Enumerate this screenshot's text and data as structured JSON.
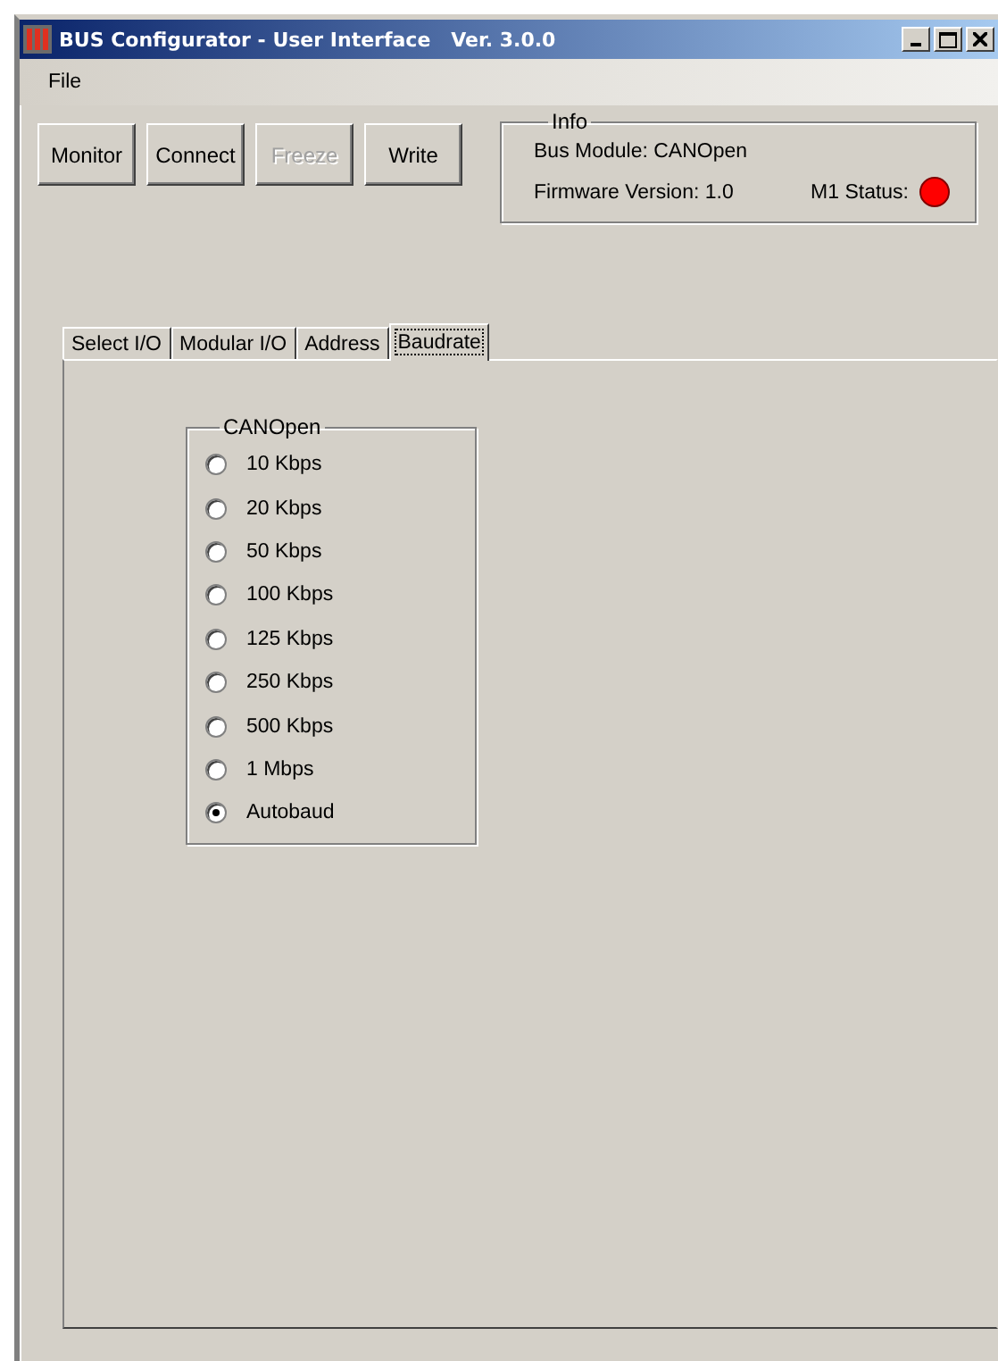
{
  "window": {
    "title": "BUS Configurator - User Interface   Ver. 3.0.0"
  },
  "menu": [
    "File"
  ],
  "buttons": [
    {
      "label": "Monitor",
      "disabled": false
    },
    {
      "label": "Connect",
      "disabled": false
    },
    {
      "label": "Freeze",
      "disabled": true
    },
    {
      "label": "Write",
      "disabled": false
    }
  ],
  "info": {
    "title": "Info",
    "bus_module": "Bus Module: CANOpen",
    "firmware": "Firmware Version: 1.0",
    "status_label": "M1 Status:"
  },
  "tabs": [
    {
      "label": "Select I/O",
      "selected": false
    },
    {
      "label": "Modular I/O",
      "selected": false
    },
    {
      "label": "Address",
      "selected": false
    },
    {
      "label": "Baudrate",
      "selected": true
    }
  ],
  "baudrate_group": {
    "title": "CANOpen",
    "options": [
      {
        "label": "10 Kbps",
        "selected": false
      },
      {
        "label": "20 Kbps",
        "selected": false
      },
      {
        "label": "50 Kbps",
        "selected": false
      },
      {
        "label": "100 Kbps",
        "selected": false
      },
      {
        "label": "125 Kbps",
        "selected": false
      },
      {
        "label": "250 Kbps",
        "selected": false
      },
      {
        "label": "500 Kbps",
        "selected": false
      },
      {
        "label": "1 Mbps",
        "selected": false
      },
      {
        "label": "Autobaud",
        "selected": true
      }
    ]
  }
}
